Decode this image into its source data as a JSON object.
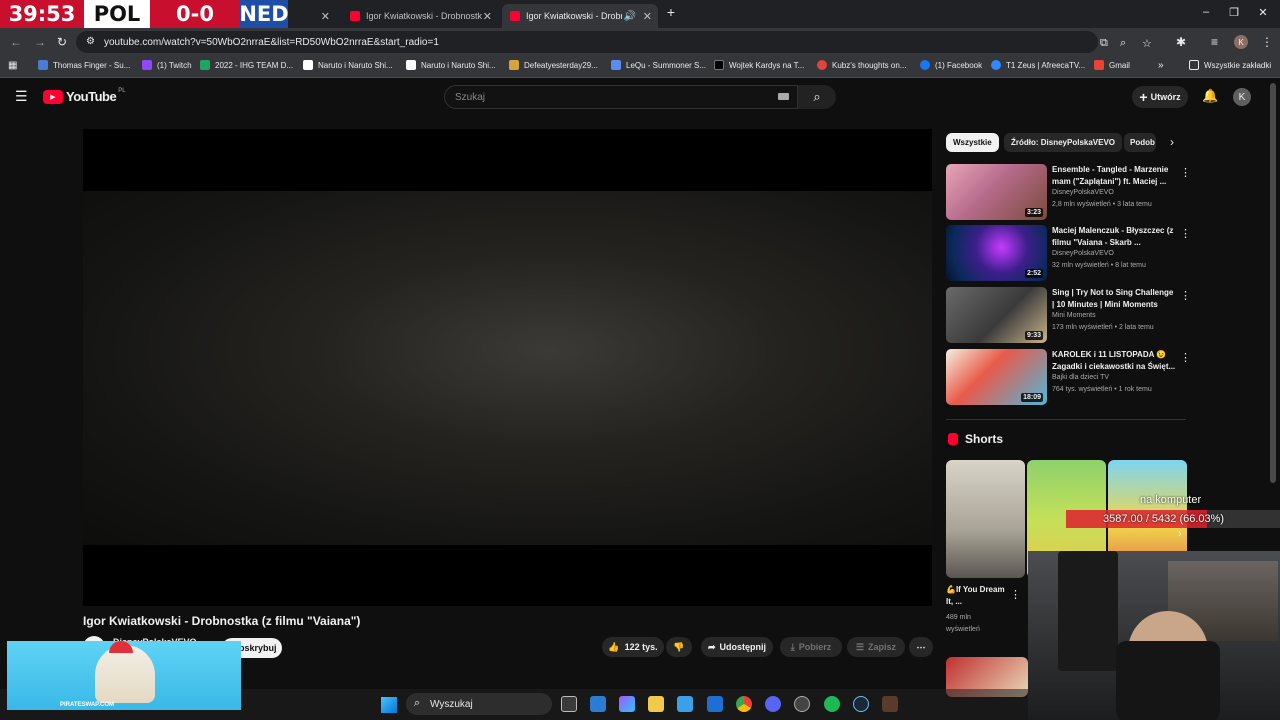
{
  "scoreboard": {
    "team_left": "POL",
    "score": "0-0",
    "team_right": "NED",
    "time": "39:53"
  },
  "tabs": [
    {
      "label": "Igor Kwiatkowski - Drobnostka"
    },
    {
      "label": "Igor Kwiatkowski - Drobno"
    }
  ],
  "address": {
    "url": "youtube.com/watch?v=50WbO2nrraE&list=RD50WbO2nrraE&start_radio=1"
  },
  "bookmarks": [
    "Thomas Finger - Su...",
    "(1) Twitch",
    "2022 - IHG TEAM D...",
    "Naruto i Naruto Shi...",
    "Naruto i Naruto Shi...",
    "Defeatyesterday29...",
    "LeQu - Summoner S...",
    "Wojtek Kardys na T...",
    "Kubz's thoughts on...",
    "(1) Facebook",
    "T1 Zeus | AfreecaTV...",
    "Gmail"
  ],
  "bookmarks_all": "Wszystkie zakładki",
  "youtube": {
    "logo_text": "YouTube",
    "logo_region": "PL",
    "search_placeholder": "Szukaj",
    "create_label": "Utwórz",
    "avatar_letter": "K",
    "video_title": "Igor Kwiatkowski - Drobnostka (z filmu \"Vaiana\")",
    "channel": "DisneyPolskaVEVO",
    "subscribe": "Subskrybuj",
    "likes": "122 tys.",
    "share": "Udostępnij",
    "download": "Pobierz",
    "save": "Zapisz"
  },
  "chips": [
    "Wszystkie",
    "Źródło: DisneyPolskaVEVO",
    "Podob"
  ],
  "recommendations": [
    {
      "title": "Ensemble - Tangled - Marzenie mam (\"Zaplątani\") ft. Maciej ...",
      "channel": "DisneyPolskaVEVO",
      "meta": "2,8 mln wyświetleń • 3 lata temu",
      "duration": "3:23"
    },
    {
      "title": "Maciej Malenczuk - Błyszczec (z filmu \"Vaiana - Skarb ...",
      "channel": "DisneyPolskaVEVO",
      "meta": "32 mln wyświetleń • 8 lat temu",
      "duration": "2:52"
    },
    {
      "title": "Sing | Try Not to Sing Challenge | 10 Minutes | Mini Moments",
      "channel": "Mini Moments",
      "meta": "173 mln wyświetleń • 2 lata temu",
      "duration": "9:33"
    },
    {
      "title": "KAROLEK i 11 LISTOPADA 😉 Zagadki i ciekawostki na Święt...",
      "channel": "Bajki dla dzieci TV",
      "meta": "764 tys. wyświetleń • 1 rok temu",
      "duration": "18:09"
    }
  ],
  "shorts": {
    "heading": "Shorts",
    "first_title": "💪If You Dream It, ...",
    "first_views": "489 mln wyświetleń"
  },
  "overlay": {
    "label": "na komputer",
    "progress_text": "3587.00 / 5432 (66.03%)",
    "progress_fraction": 0.6603,
    "ad_text": "PIRATESWAP.COM"
  },
  "taskbar": {
    "search": "Wyszukaj"
  },
  "colors": {
    "yt_red": "#ff0033",
    "chip_selected": "#f1f1f1",
    "pol_red": "#c8102e",
    "ned_blue": "#1e4fa8"
  }
}
